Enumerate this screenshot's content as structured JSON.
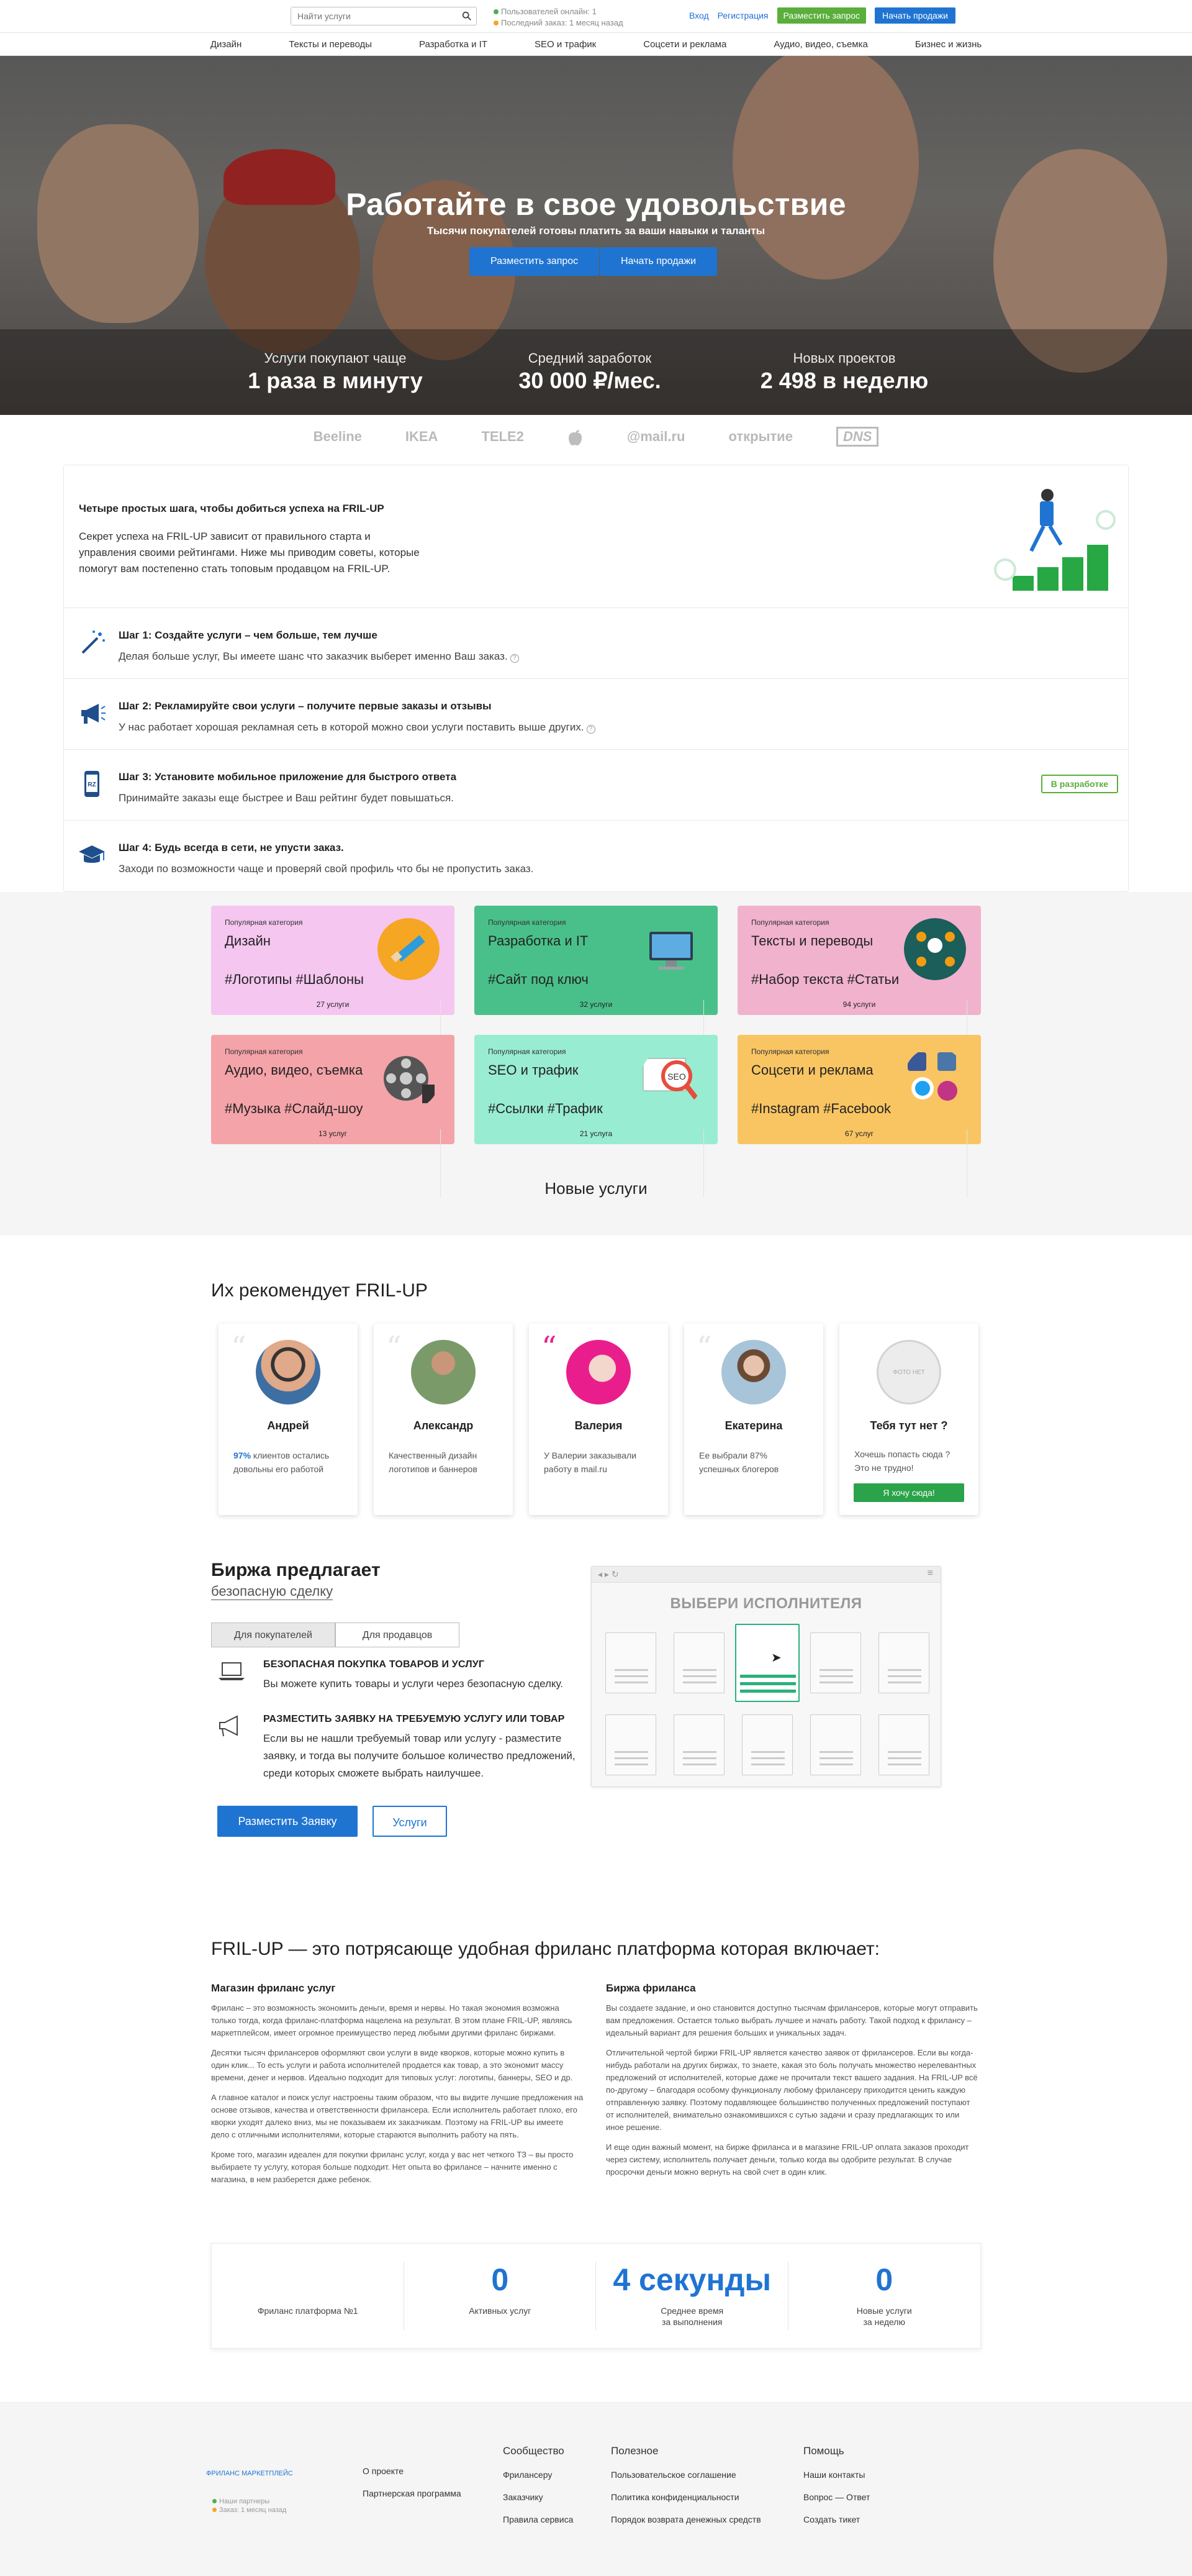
{
  "header": {
    "search_placeholder": "Найти услуги",
    "online_users": "Пользователей онлайн: 1",
    "last_order": "Последний заказ: 1 месяц назад",
    "login": "Вход",
    "register": "Регистрация",
    "post_request": "Разместить запрос",
    "start_selling": "Начать продажи"
  },
  "nav": [
    "Дизайн",
    "Тексты и переводы",
    "Разработка и IT",
    "SEO и трафик",
    "Соцсети и реклама",
    "Аудио, видео, съемка",
    "Бизнес и жизнь"
  ],
  "hero": {
    "title": "Работайте в свое удовольствие",
    "subtitle": "Тысячи покупателей готовы платить за ваши навыки и таланты",
    "btn_request": "Разместить запрос",
    "btn_sell": "Начать продажи",
    "stats": [
      {
        "label": "Услуги покупают чаще",
        "value": "1 раза в минуту"
      },
      {
        "label": "Средний заработок",
        "value": "30 000 ₽/мес."
      },
      {
        "label": "Новых проектов",
        "value": "2 498 в неделю"
      }
    ]
  },
  "partners": [
    "Beeline",
    "IKEA",
    "TELE2",
    "",
    "@mail.ru",
    "открытие",
    "DNS"
  ],
  "steps": {
    "title": "Четыре простых шага, чтобы добиться успеха на FRIL-UP",
    "intro": "Секрет успеха на FRIL-UP зависит от правильного старта и управления своими рейтингами. Ниже мы приводим советы, которые помогут вам постепенно стать топовым продавцом на FRIL-UP.",
    "items": [
      {
        "title": "Шаг 1: Создайте услуги – чем больше, тем лучше",
        "desc": "Делая больше услуг, Вы имеете шанс что заказчик выберет именно Ваш заказ."
      },
      {
        "title": "Шаг 2: Рекламируйте свои услуги – получите первые заказы и отзывы",
        "desc": "У нас работает хорошая рекламная сеть в которой можно свои услуги поставить выше других."
      },
      {
        "title": "Шаг 3: Установите мобильное приложение для быстрого ответа",
        "desc": "Принимайте заказы еще быстрее и Ваш рейтинг будет повышаться."
      },
      {
        "title": "Шаг 4: Будь всегда в сети, не упусти заказ.",
        "desc": "Заходи по возможности чаще и проверяй свой профиль что бы не пропустить заказ."
      }
    ],
    "dev_badge": "В разработке"
  },
  "categories": {
    "popular_label": "Популярная категория",
    "items": [
      {
        "name": "Дизайн",
        "tags": "#Логотипы #Шаблоны",
        "count": "27 услуги",
        "color": "#f5c6f0"
      },
      {
        "name": "Разработка и IT",
        "tags": "#Сайт под ключ",
        "count": "32 услуги",
        "color": "#49c08a"
      },
      {
        "name": "Тексты и переводы",
        "tags": "#Набор текста #Статьи",
        "count": "94 услуги",
        "color": "#f1b2cd"
      },
      {
        "name": "Аудио, видео, съемка",
        "tags": "#Музыка #Слайд-шоу",
        "count": "13 услуг",
        "color": "#f4a3a8"
      },
      {
        "name": "SEO и трафик",
        "tags": "#Ссылки #Трафик",
        "count": "21 услуга",
        "color": "#98ecd2"
      },
      {
        "name": "Соцсети и реклама",
        "tags": "#Instagram #Facebook",
        "count": "67 услуг",
        "color": "#f9c563"
      }
    ],
    "new_services": "Новые услуги"
  },
  "recommend": {
    "title": "Их рекомендует FRIL-UP",
    "people": [
      {
        "name": "Андрей",
        "pre": "97%",
        "desc": " клиентов остались довольны его работой"
      },
      {
        "name": "Александр",
        "pre": "",
        "desc": "Качественный дизайн логотипов и баннеров"
      },
      {
        "name": "Валерия",
        "pre": "",
        "desc": "У Валерии заказывали работу в mail.ru"
      },
      {
        "name": "Екатерина",
        "pre": "",
        "desc": "Ее выбрали 87% успешных блогеров"
      }
    ],
    "you": {
      "name": "Тебя тут нет ?",
      "desc": "Хочешь попасть сюда ? Это не трудно!",
      "btn": "Я хочу сюда!",
      "photo_placeholder": "ФОТО НЕТ"
    }
  },
  "exchange": {
    "title": "Биржа предлагает",
    "subtitle": "безопасную сделку",
    "tab_buyers": "Для покупателей",
    "tab_sellers": "Для продавцов",
    "f1_title": "БЕЗОПАСНАЯ ПОКУПКА ТОВАРОВ И УСЛУГ",
    "f1_desc": "Вы можете купить товары и услуги через безопасную сделку.",
    "f2_title": "РАЗМЕСТИТЬ ЗАЯВКУ НА ТРЕБУЕМУЮ УСЛУГУ ИЛИ ТОВАР",
    "f2_desc": "Если вы не нашли требуемый товар или услугу - разместите заявку, и тогда вы получите большое количество предложений, среди которых сможете выбрать наилучшее.",
    "btn_request": "Разместить Заявку",
    "btn_services": "Услуги",
    "mock_title": "ВЫБЕРИ ИСПОЛНИТЕЛЯ"
  },
  "article": {
    "title": "FRIL-UP — это потрясающе удобная фриланс платформа которая включает:",
    "left_title": "Магазин фриланс услуг",
    "left": [
      "Фриланс – это возможность экономить деньги, время и нервы. Но такая экономия возможна только тогда, когда фриланс-платформа нацелена на результат. В этом плане FRIL-UP, являясь маркетплейсом, имеет огромное преимущество перед любыми другими фриланс биржами.",
      "Десятки тысяч фрилансеров оформляют свои услуги в виде кворков, которые можно купить в один клик... То есть услуги и работа исполнителей продается как товар, а это экономит массу времени, денег и нервов. Идеально подходит для типовых услуг: логотипы, баннеры, SEO и др.",
      "А главное каталог и поиск услуг настроены таким образом, что вы видите лучшие предложения на основе отзывов, качества и ответственности фрилансера. Если исполнитель работает плохо, его кворки уходят далеко вниз, мы не показываем их заказчикам. Поэтому на FRIL-UP вы имеете дело с отличными исполнителями, которые стараются выполнить работу на пять.",
      "Кроме того, магазин идеален для покупки фриланс услуг, когда у вас нет четкого ТЗ – вы просто выбираете ту услугу, которая больше подходит. Нет опыта во фрилансе – начните именно с магазина, в нем разберется даже ребенок."
    ],
    "right_title": "Биржа фриланса",
    "right": [
      "Вы создаете задание, и оно становится доступно тысячам фрилансеров, которые могут отправить вам предложения. Остается только выбрать лучшее и начать работу. Такой подход к фрилансу – идеальный вариант для решения больших и уникальных задач.",
      "Отличительной чертой биржи FRIL-UP является качество заявок от фрилансеров. Если вы когда-нибудь работали на других биржах, то знаете, какая это боль получать множество нерелевантных предложений от исполнителей, которые даже не прочитали текст вашего задания. На FRIL-UP всё по-другому – благодаря особому функционалу любому фрилансеру приходится ценить каждую отправленную заявку. Поэтому подавляющее большинство полученных предложений поступают от исполнителей, внимательно ознакомившихся с сутью задачи и сразу предлагающих то или иное решение.",
      "И еще один важный момент, на бирже фриланса и в магазине FRIL-UP оплата заказов проходит через систему, исполнитель получает деньги, только когда вы одобрите результат. В случае просрочки деньги можно вернуть на свой счет в один клик."
    ]
  },
  "counters": [
    {
      "value": "",
      "label": "Фриланс платформа №1"
    },
    {
      "value": "0",
      "label": "Активных услуг"
    },
    {
      "value": "4 секунды",
      "label": "Среднее время\nза выполнения"
    },
    {
      "value": "0",
      "label": "Новые услуги\nза неделю"
    }
  ],
  "footer": {
    "brand": "ФРИЛАНС МАРКЕТПЛЕЙС",
    "partners_online": "Наши партнеры",
    "last_order": "Заказ: 1 месяц назад",
    "col1": [
      "О проекте",
      "Партнерская программа"
    ],
    "community_title": "Сообщество",
    "community": [
      "Фрилансеру",
      "Заказчику",
      "Правила сервиса"
    ],
    "useful_title": "Полезное",
    "useful": [
      "Пользовательское соглашение",
      "Политика конфиденциальности",
      "Порядок возврата денежных средств"
    ],
    "help_title": "Помощь",
    "help": [
      "Наши контакты",
      "Вопрос — Ответ",
      "Создать тикет"
    ]
  }
}
